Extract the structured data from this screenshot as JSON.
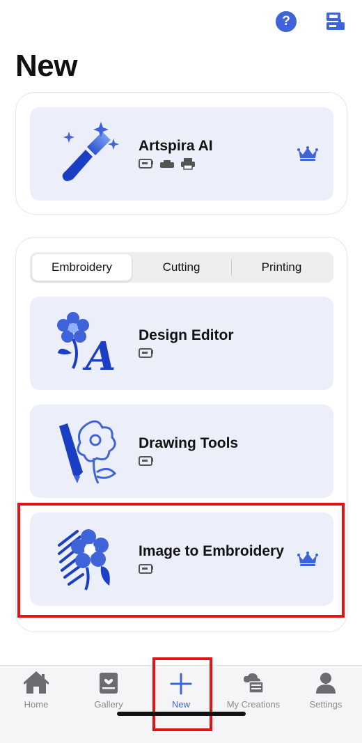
{
  "header": {
    "help_label": "?",
    "page_title": "New"
  },
  "ai_card": {
    "title": "Artspira AI",
    "compat_icons": [
      "embroidery-machine-icon",
      "cutting-machine-icon",
      "printer-icon"
    ],
    "premium": true
  },
  "segments": {
    "items": [
      {
        "label": "Embroidery",
        "active": true
      },
      {
        "label": "Cutting",
        "active": false
      },
      {
        "label": "Printing",
        "active": false
      }
    ]
  },
  "embroidery_cards": [
    {
      "title": "Design Editor",
      "compat_icons": [
        "embroidery-machine-icon"
      ],
      "premium": false
    },
    {
      "title": "Drawing Tools",
      "compat_icons": [
        "embroidery-machine-icon"
      ],
      "premium": false
    },
    {
      "title": "Image to Embroidery",
      "compat_icons": [
        "embroidery-machine-icon"
      ],
      "premium": true
    }
  ],
  "tabbar": {
    "items": [
      {
        "label": "Home",
        "icon": "house-icon",
        "active": false
      },
      {
        "label": "Gallery",
        "icon": "gallery-icon",
        "active": false
      },
      {
        "label": "New",
        "icon": "plus-icon",
        "active": true
      },
      {
        "label": "My Creations",
        "icon": "cloud-folder-icon",
        "active": false
      },
      {
        "label": "Settings",
        "icon": "person-icon",
        "active": false
      }
    ]
  },
  "colors": {
    "accent": "#3f63d8",
    "card_bg": "#eceef9",
    "highlight": "#e01414",
    "tab_inactive": "#8a8a8e"
  }
}
